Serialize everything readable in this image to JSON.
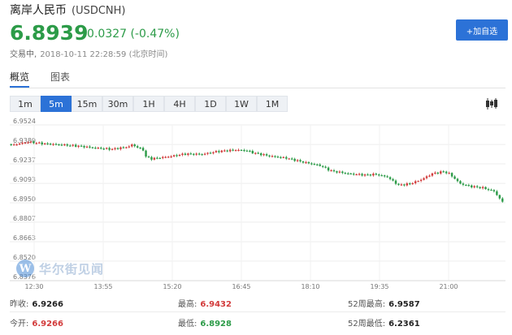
{
  "header": {
    "name": "离岸人民币",
    "code": "(USDCNH)",
    "price": "6.8939",
    "change": "-0.0327 (-0.47%)",
    "status_label": "交易中,",
    "timestamp": "2018-10-11 22:28:59 (北京时间)",
    "add_button": "+加自选"
  },
  "tabs": [
    "概览",
    "图表"
  ],
  "intervals": [
    "1m",
    "5m",
    "15m",
    "30m",
    "1H",
    "4H",
    "1D",
    "1W",
    "1M"
  ],
  "active_interval": "5m",
  "watermark": {
    "mark": "W",
    "text": "华尔街见闻"
  },
  "colors": {
    "up": "#d23b3b",
    "down": "#2c9b48",
    "accent": "#2c72d7"
  },
  "stats": [
    [
      {
        "label": "昨收:",
        "value": "6.9266",
        "tone": "neutral"
      },
      {
        "label": "最高:",
        "value": "6.9432",
        "tone": "red"
      },
      {
        "label": "52周最高:",
        "value": "6.9587",
        "tone": "neutral"
      }
    ],
    [
      {
        "label": "今开:",
        "value": "6.9266",
        "tone": "red"
      },
      {
        "label": "最低:",
        "value": "6.8928",
        "tone": "green"
      },
      {
        "label": "52周最低:",
        "value": "6.2361",
        "tone": "neutral"
      }
    ]
  ],
  "chart_data": {
    "type": "candlestick",
    "ylim": [
      6.8376,
      6.9524
    ],
    "yticks": [
      "6.9524",
      "6.9380",
      "6.9237",
      "6.9093",
      "6.8950",
      "6.8807",
      "6.8663",
      "6.8520",
      "6.8376"
    ],
    "xticks": [
      "12:30",
      "13:55",
      "15:20",
      "16:45",
      "18:10",
      "19:35",
      "21:00"
    ],
    "grid": true,
    "anchors": [
      [
        0,
        6.9375
      ],
      [
        6,
        6.9398
      ],
      [
        12,
        6.9385
      ],
      [
        18,
        6.9378
      ],
      [
        24,
        6.9368
      ],
      [
        30,
        6.9355
      ],
      [
        36,
        6.9345
      ],
      [
        42,
        6.9365
      ],
      [
        43,
        6.9378
      ],
      [
        47,
        6.934
      ],
      [
        48,
        6.929
      ],
      [
        50,
        6.9275
      ],
      [
        56,
        6.929
      ],
      [
        62,
        6.931
      ],
      [
        68,
        6.9308
      ],
      [
        74,
        6.933
      ],
      [
        80,
        6.934
      ],
      [
        84,
        6.9335
      ],
      [
        86,
        6.932
      ],
      [
        92,
        6.9295
      ],
      [
        98,
        6.928
      ],
      [
        104,
        6.925
      ],
      [
        110,
        6.9225
      ],
      [
        114,
        6.9185
      ],
      [
        120,
        6.9165
      ],
      [
        126,
        6.9155
      ],
      [
        130,
        6.916
      ],
      [
        134,
        6.914
      ],
      [
        138,
        6.908
      ],
      [
        142,
        6.909
      ],
      [
        146,
        6.912
      ],
      [
        150,
        6.9165
      ],
      [
        154,
        6.918
      ],
      [
        156,
        6.9165
      ],
      [
        160,
        6.909
      ],
      [
        164,
        6.907
      ],
      [
        168,
        6.906
      ],
      [
        172,
        6.9035
      ],
      [
        175,
        6.8955
      ]
    ]
  }
}
